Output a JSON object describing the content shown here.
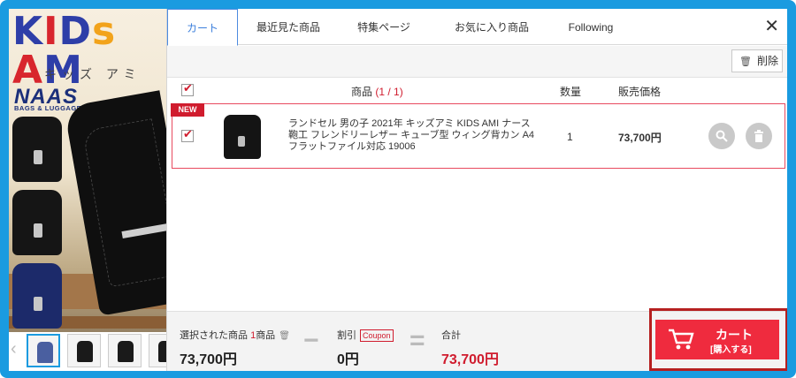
{
  "promo": {
    "logo_text": "KIDS AMI",
    "logo_kana": "キッズ アミ",
    "brand": "NAAS",
    "brand_sub": "BAGS & LUGGAGE"
  },
  "tabs": [
    {
      "label": "カート",
      "active": true
    },
    {
      "label": "最近見た商品"
    },
    {
      "label": "特集ページ"
    },
    {
      "label": "お気に入り商品"
    },
    {
      "label": "Following"
    }
  ],
  "toolbar": {
    "delete_label": "削除"
  },
  "table": {
    "header_product": "商品",
    "header_count": "(1 / 1)",
    "header_qty": "数量",
    "header_price": "販売価格"
  },
  "items": [
    {
      "badge": "NEW",
      "name": "ランドセル 男の子 2021年 キッズアミ KIDS AMI ナース鞄工 フレンドリーレザー キューブ型 ウィング背カン A4フラットファイル対応 19006",
      "qty": "1",
      "price": "73,700円"
    }
  ],
  "footer": {
    "selected_label": "選択された商品",
    "selected_count": "1",
    "selected_unit": "商品",
    "selected_amount": "73,700円",
    "minus": "−",
    "discount_label": "割引",
    "coupon_label": "Coupon",
    "discount_amount": "0円",
    "equals": "=",
    "total_label": "合計",
    "total_amount": "73,700円"
  },
  "cart_button": {
    "label": "カート",
    "sub_label": "[購入する]"
  },
  "colors": {
    "frame": "#1a9be0",
    "accent_red": "#ef2b3e",
    "tab_active": "#3c7fdc"
  }
}
